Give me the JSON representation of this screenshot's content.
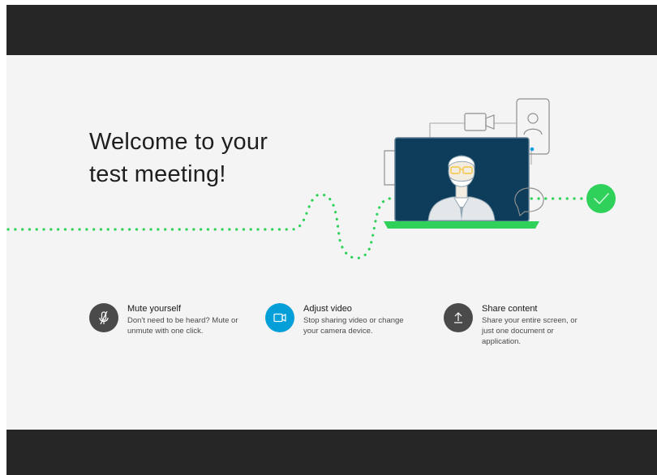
{
  "welcome": {
    "title_line1": "Welcome to your",
    "title_line2": "test meeting!"
  },
  "features": [
    {
      "icon": "microphone-muted-icon",
      "heading": "Mute yourself",
      "description": "Don't need to be heard? Mute or unmute with one click."
    },
    {
      "icon": "video-camera-icon",
      "heading": "Adjust video",
      "description": "Stop sharing video or change your camera device."
    },
    {
      "icon": "share-upload-icon",
      "heading": "Share content",
      "description": "Share your entire screen, or just one document or application."
    }
  ],
  "colors": {
    "chrome": "#262626",
    "background": "#f4f4f4",
    "accent_green": "#2fd15a",
    "accent_blue": "#049fd9",
    "icon_gray": "#4a4a4a",
    "screen_navy": "#0d3d5b"
  }
}
